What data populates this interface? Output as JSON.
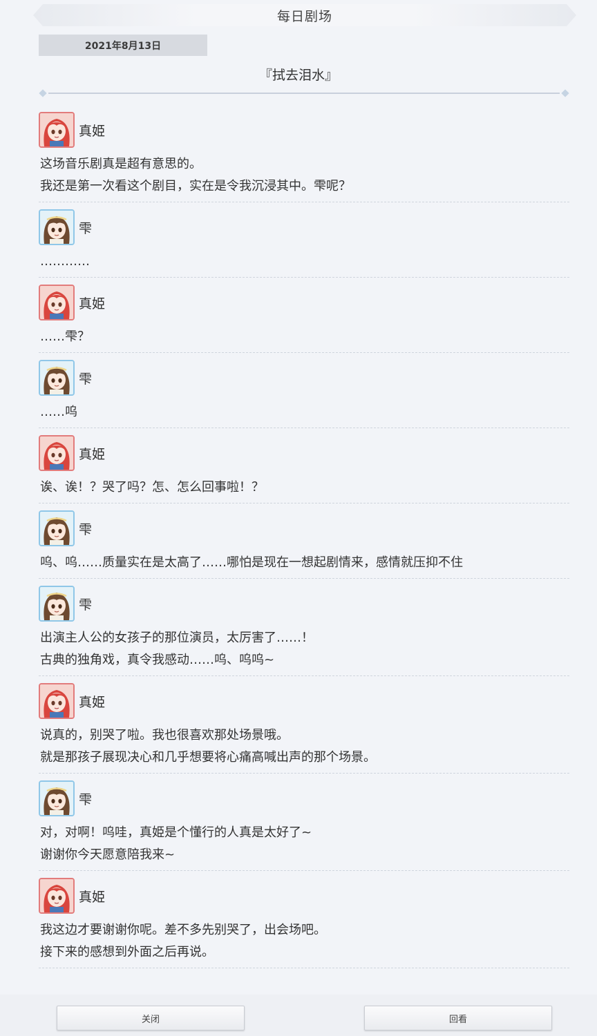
{
  "header": {
    "title": "每日剧场"
  },
  "date": "2021年8月13日",
  "story_title": "『拭去泪水』",
  "colors": {
    "maki_frame": "#e27b7b",
    "nozomi_frame": "#8fc7e8",
    "background": "#f2f4f8"
  },
  "dialog": [
    {
      "speaker": "真姫",
      "avatar": "maki-avatar-icon",
      "lines": [
        "这场音乐剧真是超有意思的。",
        "我还是第一次看这个剧目，实在是令我沉浸其中。雫呢？"
      ]
    },
    {
      "speaker": "雫",
      "avatar": "shizuku-avatar-icon",
      "lines": [
        "…………"
      ]
    },
    {
      "speaker": "真姫",
      "avatar": "maki-avatar-icon",
      "lines": [
        "……雫？"
      ]
    },
    {
      "speaker": "雫",
      "avatar": "shizuku-avatar-icon",
      "lines": [
        "……呜"
      ]
    },
    {
      "speaker": "真姫",
      "avatar": "maki-avatar-icon",
      "lines": [
        "诶、诶！？哭了吗？怎、怎么回事啦！？"
      ]
    },
    {
      "speaker": "雫",
      "avatar": "shizuku-avatar-icon",
      "lines": [
        "呜、呜……质量实在是太高了……哪怕是现在一想起剧情来，感情就压抑不住"
      ]
    },
    {
      "speaker": "雫",
      "avatar": "shizuku-avatar-icon",
      "lines": [
        "出演主人公的女孩子的那位演员，太厉害了……！",
        "古典的独角戏，真令我感动……呜、呜呜~"
      ]
    },
    {
      "speaker": "真姫",
      "avatar": "maki-avatar-icon",
      "lines": [
        "说真的，别哭了啦。我也很喜欢那处场景哦。",
        "就是那孩子展现决心和几乎想要将心痛高喊出声的那个场景。"
      ]
    },
    {
      "speaker": "雫",
      "avatar": "shizuku-avatar-icon",
      "lines": [
        "对，对啊！呜哇，真姫是个懂行的人真是太好了~",
        "谢谢你今天愿意陪我来~"
      ]
    },
    {
      "speaker": "真姫",
      "avatar": "maki-avatar-icon",
      "lines": [
        "我这边才要谢谢你呢。差不多先别哭了，出会场吧。",
        "接下来的感想到外面之后再说。"
      ]
    }
  ],
  "footer": {
    "close_label": "关闭",
    "review_label": "回看"
  }
}
